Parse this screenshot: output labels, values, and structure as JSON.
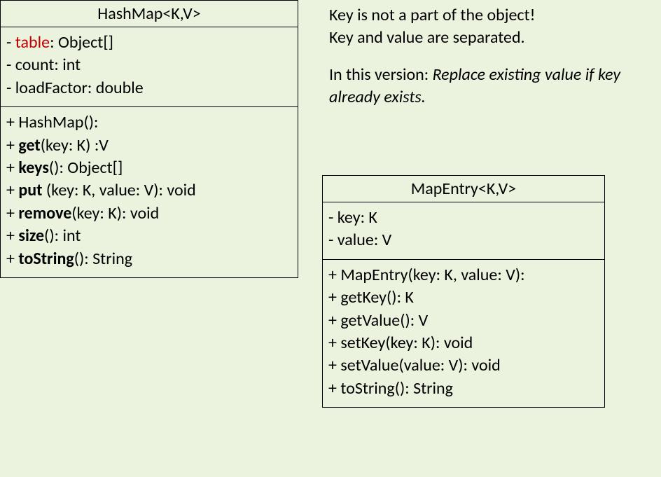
{
  "classes": {
    "hashmap": {
      "title": "HashMap<K,V>",
      "attrs": [
        {
          "vis": "- ",
          "name": "table",
          "type": ": Object[]",
          "highlight": true
        },
        {
          "vis": "- ",
          "name": "count",
          "type": ": int",
          "highlight": false
        },
        {
          "vis": "- ",
          "name": "loadFactor",
          "type": ": double",
          "highlight": false
        }
      ],
      "ops": [
        {
          "vis": "+ ",
          "name": "HashMap",
          "sig": "():",
          "bold": false
        },
        {
          "vis": "+ ",
          "name": "get",
          "sig": "(key: K) :V",
          "bold": true
        },
        {
          "vis": "+ ",
          "name": "keys",
          "sig": "(): Object[]",
          "bold": true
        },
        {
          "vis": "+ ",
          "name": "put ",
          "sig": "(key: K, value: V): void",
          "bold": true
        },
        {
          "vis": "+ ",
          "name": "remove",
          "sig": "(key: K): void",
          "bold": true
        },
        {
          "vis": "+ ",
          "name": "size",
          "sig": "(): int",
          "bold": true
        },
        {
          "vis": "+ ",
          "name": "toString",
          "sig": "(): String",
          "bold": true
        }
      ]
    },
    "mapentry": {
      "title": "MapEntry<K,V>",
      "attrs": [
        {
          "vis": "- ",
          "name": "key",
          "type": ": K"
        },
        {
          "vis": "- ",
          "name": "value",
          "type": ": V"
        }
      ],
      "ops": [
        {
          "vis": "+ ",
          "name": "MapEntry",
          "sig": "(key: K, value: V):"
        },
        {
          "vis": "+ ",
          "name": "getKey",
          "sig": "(): K"
        },
        {
          "vis": "+ ",
          "name": "getValue",
          "sig": "(): V"
        },
        {
          "vis": "+ ",
          "name": "setKey",
          "sig": "(key: K): void"
        },
        {
          "vis": "+ ",
          "name": "setValue",
          "sig": "(value: V): void"
        },
        {
          "vis": "+ ",
          "name": "toString",
          "sig": "(): String"
        }
      ]
    }
  },
  "notes": {
    "line1": "Key is not a part of the object!",
    "line2": "Key and value are separated.",
    "line3_prefix": "In this version: ",
    "line3_italic": "Replace existing value if key already exists."
  }
}
